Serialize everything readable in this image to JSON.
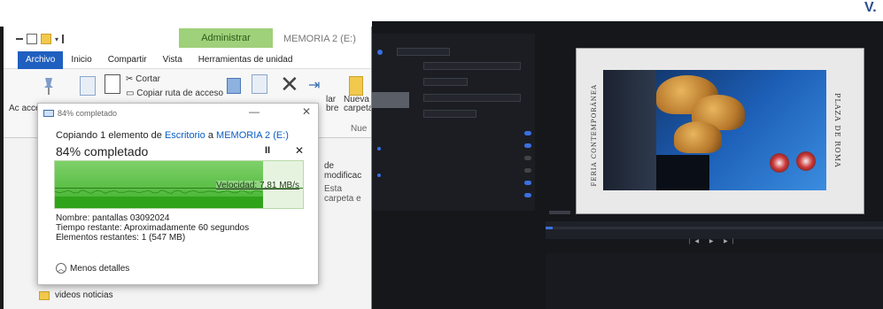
{
  "explorer": {
    "ribbon_tabs": [
      "Archivo",
      "Inicio",
      "Compartir",
      "Vista",
      "Herramientas de unidad"
    ],
    "manage_tab": "Administrar",
    "window_title": "MEMORIA 2 (E:)",
    "ribbon": {
      "cut": "Cortar",
      "copy_path": "Copiar ruta de acceso",
      "clipboard_partial": "Ac acce",
      "select_partial": "lar bre",
      "new_folder": "Nueva carpeta",
      "new_group": "Nue"
    },
    "column_partial": "de modificac",
    "empty_partial": "Esta carpeta e",
    "tree_item": "videos noticias"
  },
  "copy_dialog": {
    "title": "84% completado",
    "copying_prefix": "Copiando 1 elemento de",
    "source": "Escritorio",
    "connector": "a",
    "destination": "MEMORIA 2 (E:)",
    "percent_text": "84% completado",
    "progress": 0.84,
    "pause": "II",
    "close": "✕",
    "speed": "Velocidad: 7,81 MB/s",
    "name_line": "Nombre: pantallas 03092024",
    "time_line": "Tiempo restante: Aproximadamente 60 segundos",
    "items_line": "Elementos restantes: 1 (547 MB)",
    "less_details": "Menos detalles"
  },
  "editor": {
    "corner_mark": "V.",
    "preview_text_left": "FERIA CONTEMPORÁNEA",
    "preview_text_right": "PLAZA DE ROMA",
    "accent": "#3b6fe0"
  }
}
